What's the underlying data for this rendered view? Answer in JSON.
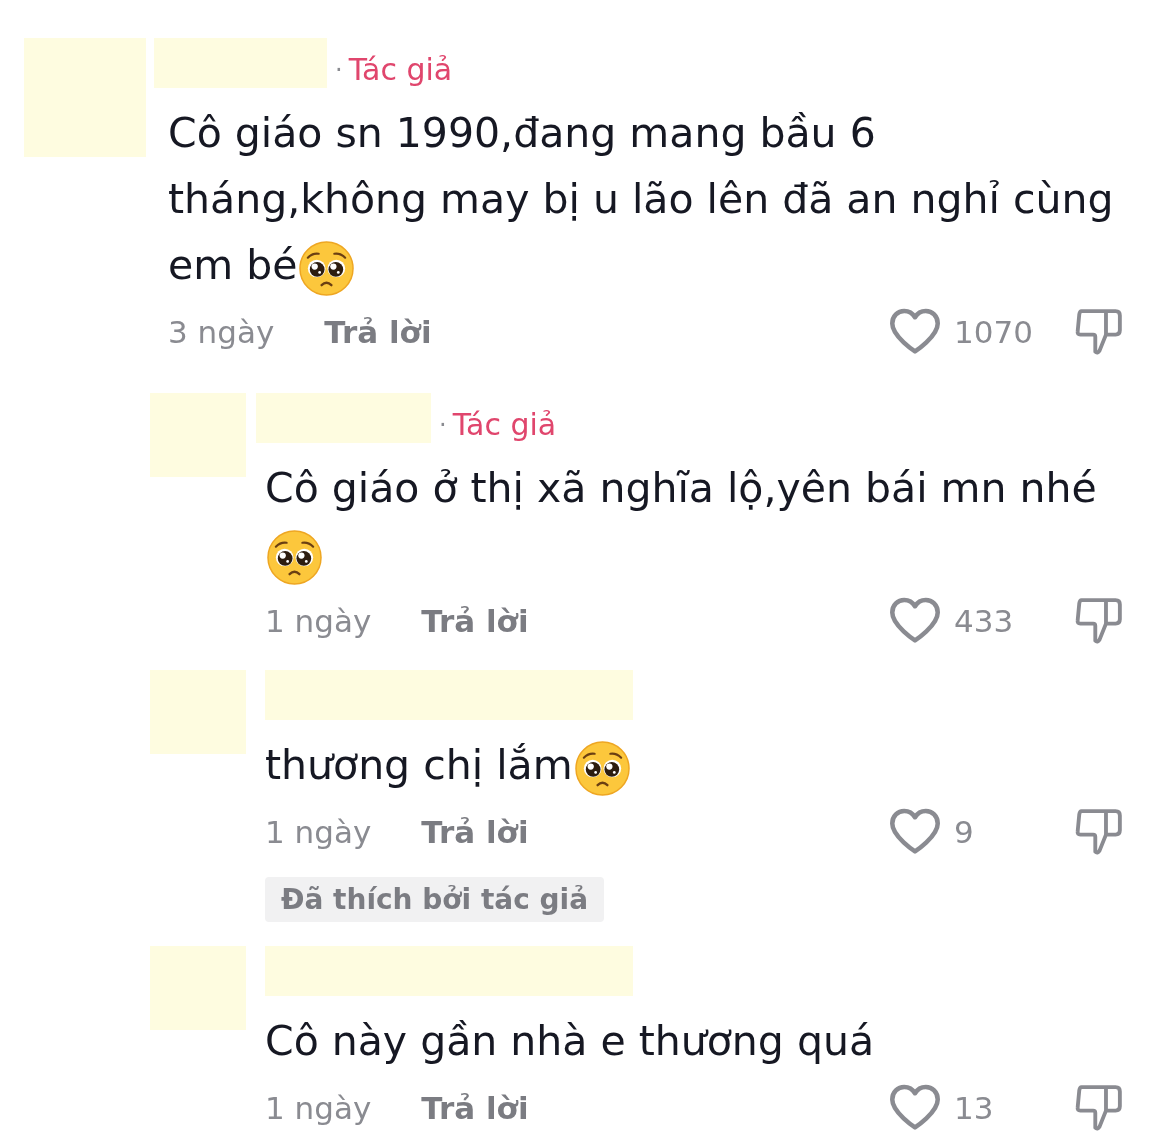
{
  "comments": [
    {
      "author_tag": {
        "dot": "·",
        "label": "Tác giả"
      },
      "text": "Cô giáo sn 1990,đang mang bầu 6 tháng,không may bị u lão lên đã an nghỉ cùng em bé",
      "emoji": true,
      "time": "3 ngày",
      "reply_action": "Trả lời",
      "liked": false,
      "likes": "1070",
      "replies": [
        {
          "author_tag": {
            "dot": "·",
            "label": "Tác giả"
          },
          "text": "Cô giáo ở thị xã nghĩa lộ,yên bái mn nhé",
          "emoji": true,
          "time": "1 ngày",
          "reply_action": "Trả lời",
          "liked": false,
          "likes": "433"
        },
        {
          "text": "thương chị lắm",
          "emoji": true,
          "time": "1 ngày",
          "reply_action": "Trả lời",
          "liked": false,
          "likes": "9",
          "liked_by_author": "Đã thích bởi tác giả"
        },
        {
          "text": "Cô này gần nhà e thương quá",
          "emoji": false,
          "time": "1 ngày",
          "reply_action": "Trả lời",
          "liked": false,
          "likes": "13"
        }
      ]
    }
  ]
}
